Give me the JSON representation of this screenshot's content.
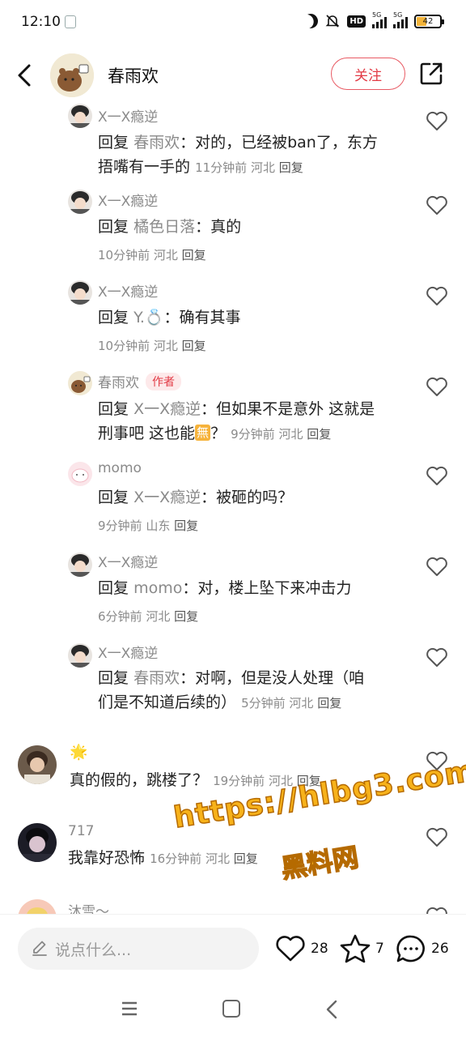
{
  "status_bar": {
    "time": "12:10",
    "network_badge": "HD",
    "sim1_label": "5G",
    "sim2_label": "5G",
    "battery": "42",
    "battery_level": 0.42
  },
  "header": {
    "title": "春雨欢",
    "follow_label": "关注"
  },
  "comments": [
    {
      "username": "X一X瘾逆",
      "reply_prefix": "回复",
      "reply_to": "春雨欢",
      "text_line1": "：对的，已经被ban了，东方",
      "text_line2": "捂嘴有一手的",
      "time": "11分钟前",
      "location": "河北",
      "reply_label": "回复"
    },
    {
      "username": "X一X瘾逆",
      "reply_prefix": "回复",
      "reply_to": "橘色日落",
      "text": "：真的",
      "time": "10分钟前",
      "location": "河北",
      "reply_label": "回复"
    },
    {
      "username": "X一X瘾逆",
      "reply_prefix": "回复",
      "reply_to": "Y.💍",
      "text": "：确有其事",
      "time": "10分钟前",
      "location": "河北",
      "reply_label": "回复"
    },
    {
      "username": "春雨欢",
      "author_tag": "作者",
      "reply_prefix": "回复",
      "reply_to": "X一X瘾逆",
      "text_line1": "：但如果不是意外 这就是",
      "text_line2": "刑事吧 这也能",
      "emoji": "無",
      "text_line2_end": "？",
      "time": "9分钟前",
      "location": "河北",
      "reply_label": "回复"
    },
    {
      "username": "momo",
      "reply_prefix": "回复",
      "reply_to": "X一X瘾逆",
      "text": "：被砸的吗？",
      "time": "9分钟前",
      "location": "山东",
      "reply_label": "回复"
    },
    {
      "username": "X一X瘾逆",
      "reply_prefix": "回复",
      "reply_to": "momo",
      "text": "：对，楼上坠下来冲击力",
      "time": "6分钟前",
      "location": "河北",
      "reply_label": "回复"
    },
    {
      "username": "X一X瘾逆",
      "reply_prefix": "回复",
      "reply_to": "春雨欢",
      "text_line1": "：对啊，但是没人处理（咱",
      "text_line2": "们是不知道后续的）",
      "time": "5分钟前",
      "location": "河北",
      "reply_label": "回复"
    },
    {
      "username": "🌟",
      "text": "真的假的，跳楼了？",
      "time": "19分钟前",
      "location": "河北",
      "reply_label": "回复"
    },
    {
      "username": "717",
      "text": "我靠好恐怖",
      "time": "16分钟前",
      "location": "河北",
      "reply_label": "回复"
    },
    {
      "username": "沐雪～"
    }
  ],
  "bottom_bar": {
    "input_placeholder": "说点什么...",
    "like_count": "28",
    "collect_count": "7",
    "comment_count": "26"
  },
  "watermark": {
    "line1": "https://hlbg3.com",
    "line2": "黑料网"
  },
  "colors": {
    "accent": "#e23a45",
    "muted": "#8a8a8a",
    "watermark": "#f7b21a"
  },
  "icons": [
    "back-icon",
    "share-icon",
    "heart-icon",
    "pencil-icon",
    "star-icon",
    "comment-icon"
  ]
}
